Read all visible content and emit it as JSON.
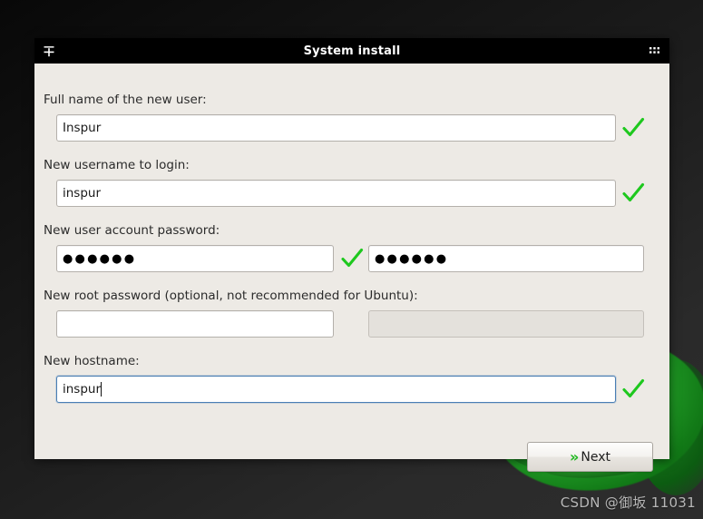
{
  "window": {
    "title": "System install",
    "menu_icon": "window-menu-icon",
    "grip_icon": "dots-grid-icon"
  },
  "form": {
    "fields": [
      {
        "label": "Full name of the new user:",
        "value": "Inspur",
        "placeholder": "",
        "valid_icon": "green-check-icon"
      },
      {
        "label": "New username to login:",
        "value": "inspur",
        "placeholder": "",
        "valid_icon": "green-check-icon"
      },
      {
        "label": "New user account password:",
        "value": "●●●●●●",
        "confirm_value": "●●●●●●",
        "placeholder": "",
        "valid_icon": "green-check-icon"
      },
      {
        "label": "New root password (optional, not recommended for Ubuntu):",
        "value": "",
        "confirm_value": "",
        "placeholder": "",
        "valid_icon": ""
      },
      {
        "label": "New hostname:",
        "value": "inspur",
        "placeholder": "",
        "valid_icon": "green-check-icon"
      }
    ]
  },
  "actions": {
    "next_label": "Next",
    "next_chevrons": "»"
  },
  "watermark": {
    "text": "CSDN @御坂 11031"
  },
  "colors": {
    "accent_green": "#1ec81e",
    "dialog_bg": "#edeae5",
    "titlebar_bg": "#000000",
    "focus_border": "#4a7fb5",
    "desktop_dark": "#1f1f1f",
    "blob_green": "#25a32a"
  }
}
